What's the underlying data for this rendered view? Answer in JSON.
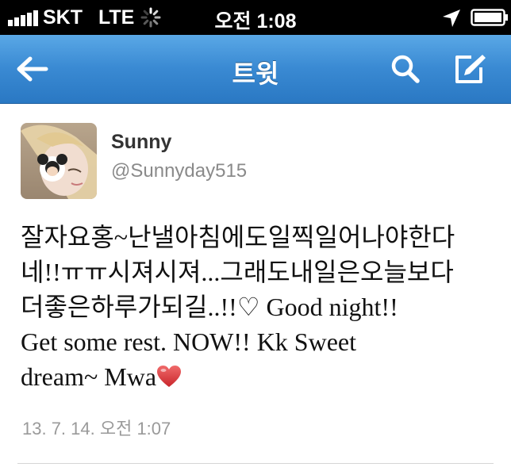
{
  "status_bar": {
    "carrier": "SKT",
    "network": "LTE",
    "time": "오전 1:08",
    "icons": [
      "signal-bars-icon",
      "activity-spinner-icon",
      "location-arrow-icon",
      "battery-icon"
    ]
  },
  "nav": {
    "title": "트윗",
    "back_icon": "back-arrow-icon",
    "search_icon": "search-icon",
    "compose_icon": "compose-icon",
    "bar_color": "#3a8ad3"
  },
  "tweet": {
    "name": "Sunny",
    "handle": "@Sunnyday515",
    "text_lines": [
      "잘자요홍~난낼아침에도일찍일어나야한다",
      "네!!ㅠㅠ시져시져...그래도내일은오늘보다",
      "더좋은하루가되길..!!♡ Good night!!",
      "Get some rest. NOW!! Kk Sweet",
      "dream~ Mwa"
    ],
    "trailing_emoji": "heart-icon",
    "timestamp": "13. 7. 14. 오전 1:07"
  }
}
